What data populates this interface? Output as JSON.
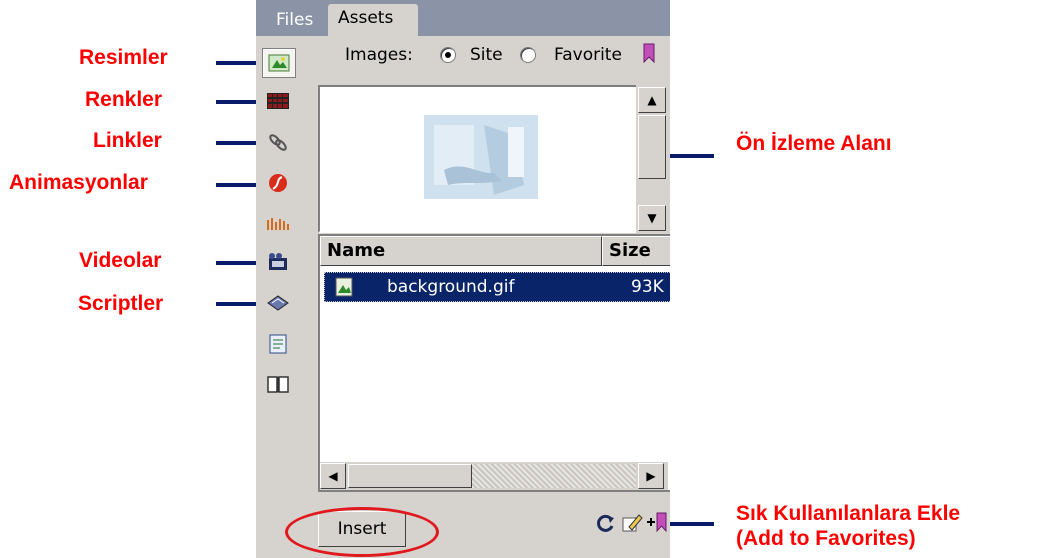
{
  "tabs": {
    "files": "Files",
    "assets": "Assets"
  },
  "images_row": {
    "label": "Images:",
    "option_site": "Site",
    "option_favorite": "Favorite",
    "selected": "Site"
  },
  "sidebar_categories": [
    "images-icon",
    "colors-icon",
    "urls-icon",
    "flash-icon",
    "shockwave-icon",
    "movies-icon",
    "scripts-icon",
    "templates-icon",
    "library-icon"
  ],
  "list": {
    "columns": [
      "Name",
      "Size"
    ],
    "rows": [
      {
        "name": "background.gif",
        "size": "93K"
      }
    ]
  },
  "buttons": {
    "insert": "Insert"
  },
  "annotations": {
    "resimler": "Resimler",
    "renkler": "Renkler",
    "linkler": "Linkler",
    "animasyonlar": "Animasyonlar",
    "videolar": "Videolar",
    "scriptler": "Scriptler",
    "preview_area": "Ön İzleme Alanı",
    "add_fav_line1": "Sık Kullanılanlara Ekle",
    "add_fav_line2": "(Add to Favorites)"
  },
  "colors": {
    "annotation_text": "#ff0000",
    "annotation_line": "#0a1a6b",
    "selection": "#0a246a",
    "highlight_ellipse": "#e0191d"
  }
}
